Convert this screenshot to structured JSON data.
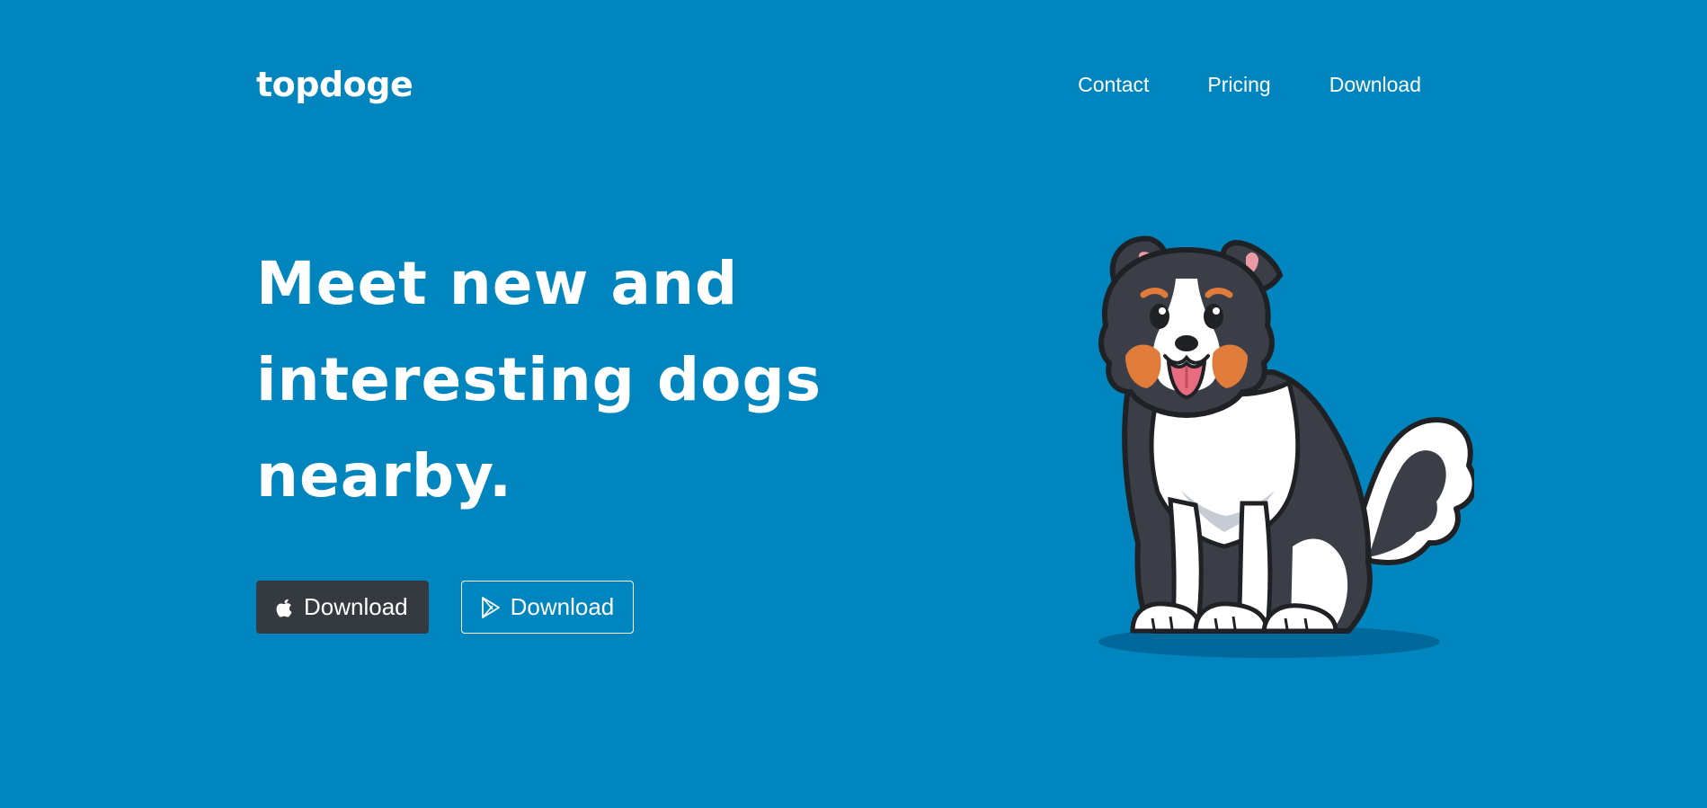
{
  "brand": "topdoge",
  "nav": {
    "links": [
      "Contact",
      "Pricing",
      "Download"
    ]
  },
  "hero": {
    "title_lines": [
      "Meet new and",
      "interesting dogs",
      "nearby."
    ]
  },
  "buttons": {
    "apple": {
      "label": "Download",
      "icon": "apple-icon"
    },
    "google": {
      "label": "Download",
      "icon": "google-play-icon"
    }
  },
  "illustration": {
    "icon": "dog-illustration"
  },
  "colors": {
    "background": "#0085be",
    "dark_button": "#343a40",
    "text": "#ffffff"
  }
}
